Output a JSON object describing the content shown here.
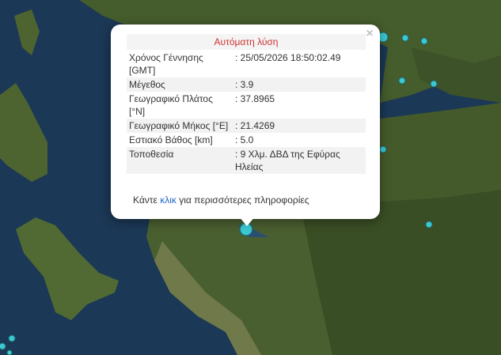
{
  "popup": {
    "title": "Αυτόματη λύση",
    "close_symbol": "×",
    "rows": [
      {
        "label": "Χρόνος Γέννησης [GMT]",
        "value": ": 25/05/2026 18:50:02.49"
      },
      {
        "label": "Μέγεθος",
        "value": ": 3.9"
      },
      {
        "label": "Γεωγραφικό Πλάτος [°N]",
        "value": ": 37.8965"
      },
      {
        "label": "Γεωγραφικό Μήκος [°E]",
        "value": ": 21.4269"
      },
      {
        "label": "Εστιακό Βάθος [km]",
        "value": ": 5.0"
      },
      {
        "label": "Τοποθεσία",
        "value": ": 9 Χλμ. ΔΒΔ της Εφύρας Ηλείας"
      }
    ],
    "more_prefix": "Κάντε ",
    "more_link": "κλικ",
    "more_suffix": " για περισσότερες πληροφορίες"
  },
  "map": {
    "sea_color": "#1c3a5a",
    "land_color": "#3f5a2c",
    "marker_color": "#3cc8d2"
  }
}
